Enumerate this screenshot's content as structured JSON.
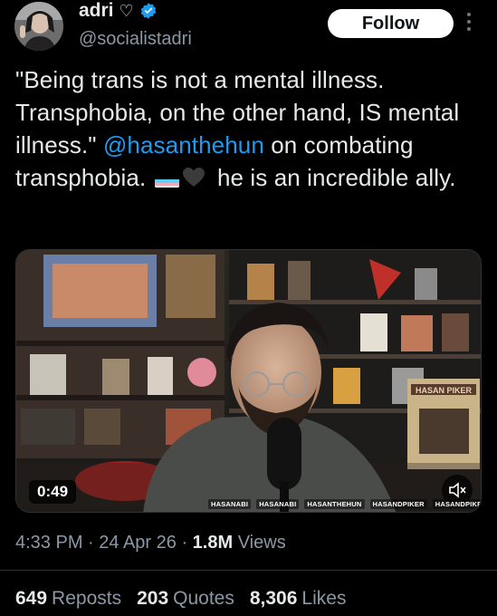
{
  "author": {
    "name": "adri",
    "name_suffix": "♡",
    "handle": "@socialistadri",
    "verified": true
  },
  "follow_label": "Follow",
  "tweet": {
    "text_before": "\"Being trans is not a mental illness. Transphobia, on the other hand, IS mental illness.\" ",
    "mention": "@hasanthehun",
    "text_middle": " on combating transphobia. ",
    "text_after": " he is an incredible ally."
  },
  "media": {
    "duration": "0:49",
    "poster_sign": "HASAN PIKER",
    "socials": [
      "HASANABI",
      "HASANABI",
      "HASANTHEHUN",
      "HASANDPIKER",
      "HASANDPIKER"
    ]
  },
  "meta": {
    "time": "4:33 PM",
    "date": "24 Apr 26",
    "views_count": "1.8M",
    "views_label": "Views"
  },
  "stats": {
    "reposts_count": "649",
    "reposts_label": "Reposts",
    "quotes_count": "203",
    "quotes_label": "Quotes",
    "likes_count": "8,306",
    "likes_label": "Likes"
  },
  "colors": {
    "mention": "#1d9bf0",
    "verified": "#1d9bf0",
    "flag_blue": "#5bcefa",
    "flag_pink": "#f5a9b8"
  }
}
